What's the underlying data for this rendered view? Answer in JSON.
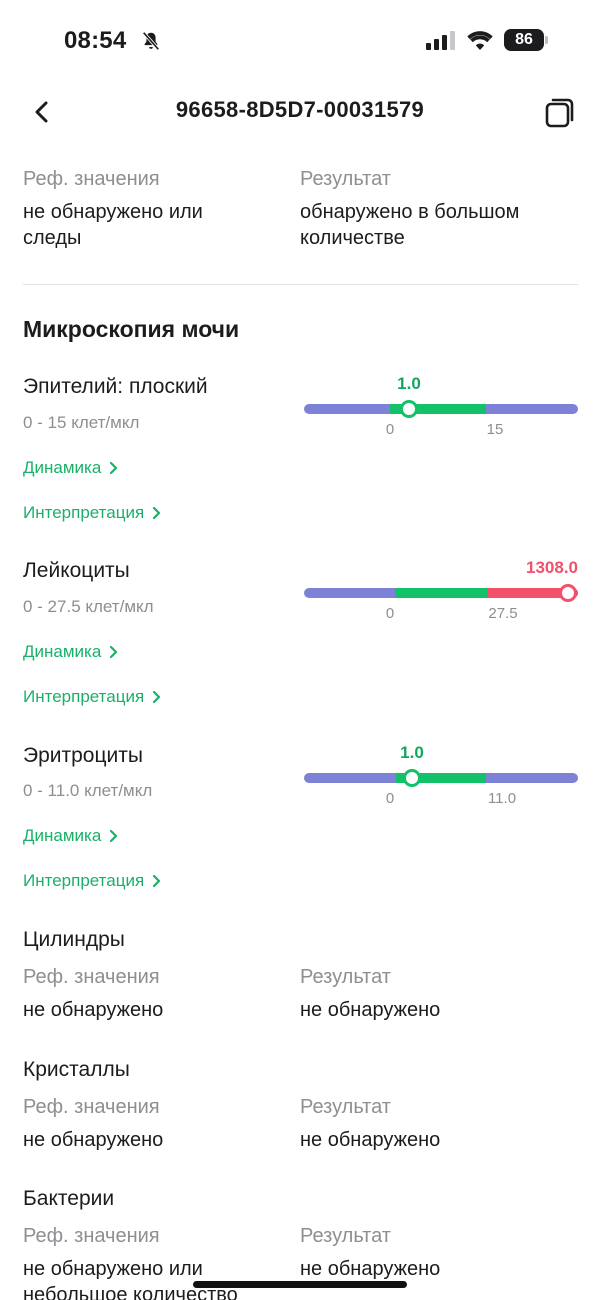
{
  "status_bar": {
    "time": "08:54",
    "battery": "86"
  },
  "header": {
    "title": "96658-8D5D7-00031579"
  },
  "top_item": {
    "ref_label": "Реф. значения",
    "ref_value": "не обнаружено или следы",
    "result_label": "Результат",
    "result_value": "обнаружено в большом количестве"
  },
  "section": {
    "title": "Микроскопия мочи"
  },
  "params": [
    {
      "name": "Эпителий: плоский",
      "range": "0 - 15 клет/мкл",
      "dynamics": "Динамика",
      "interpretation": "Интерпретация",
      "value": "1.0",
      "tick_low": "0",
      "tick_high": "15",
      "value_num": 1.0,
      "ref_low": 0,
      "ref_high": 15,
      "status": "normal"
    },
    {
      "name": "Лейкоциты",
      "range": "0 - 27.5 клет/мкл",
      "dynamics": "Динамика",
      "interpretation": "Интерпретация",
      "value": "1308.0",
      "tick_low": "0",
      "tick_high": "27.5",
      "value_num": 1308.0,
      "ref_low": 0,
      "ref_high": 27.5,
      "status": "high"
    },
    {
      "name": "Эритроциты",
      "range": "0 - 11.0 клет/мкл",
      "dynamics": "Динамика",
      "interpretation": "Интерпретация",
      "value": "1.0",
      "tick_low": "0",
      "tick_high": "11.0",
      "value_num": 1.0,
      "ref_low": 0,
      "ref_high": 11.0,
      "status": "normal"
    }
  ],
  "text_items": [
    {
      "name": "Цилиндры",
      "ref_label": "Реф. значения",
      "ref_value": "не обнаружено",
      "result_label": "Результат",
      "result_value": "не обнаружено"
    },
    {
      "name": "Кристаллы",
      "ref_label": "Реф. значения",
      "ref_value": "не обнаружено",
      "result_label": "Результат",
      "result_value": "не обнаружено"
    },
    {
      "name": "Бактерии",
      "ref_label": "Реф. значения",
      "ref_value": "не обнаружено или небольшое количество",
      "result_label": "Результат",
      "result_value": "не обнаружено"
    }
  ],
  "colors": {
    "accent_green": "#13c169",
    "link_green": "#1ab06a",
    "alert_red": "#f2506b",
    "range_blue": "#7e82d6"
  },
  "icons": [
    "bell-muted-icon",
    "signal-icon",
    "wifi-icon",
    "battery-icon",
    "chevron-left-icon",
    "copy-icon",
    "chevron-right-icon"
  ]
}
